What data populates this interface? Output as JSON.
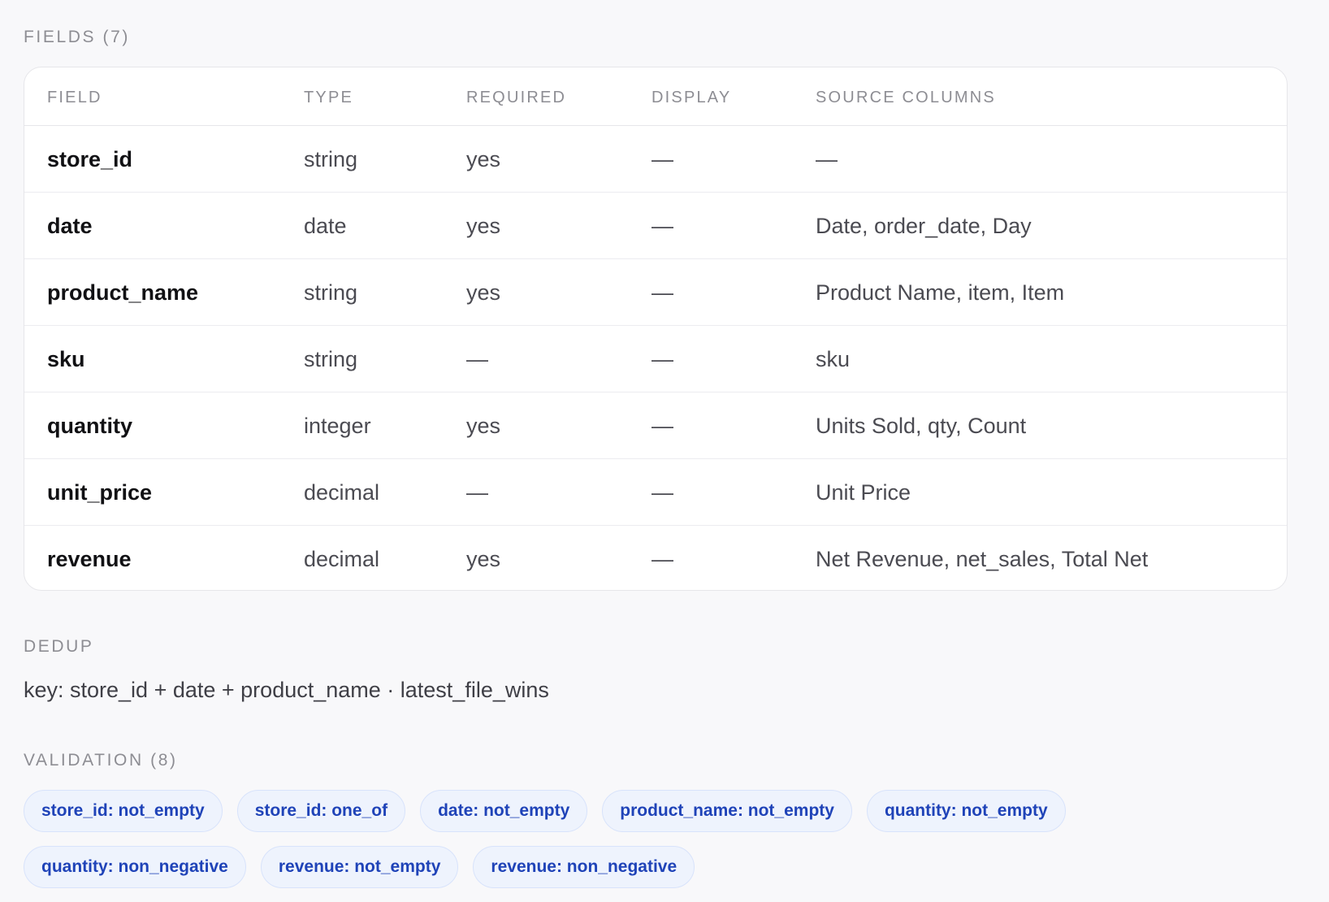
{
  "fields": {
    "title": "FIELDS (7)",
    "columns": [
      "FIELD",
      "TYPE",
      "REQUIRED",
      "DISPLAY",
      "SOURCE COLUMNS"
    ],
    "rows": [
      {
        "field": "store_id",
        "type": "string",
        "required": "yes",
        "display": "—",
        "source": "—"
      },
      {
        "field": "date",
        "type": "date",
        "required": "yes",
        "display": "—",
        "source": "Date, order_date, Day"
      },
      {
        "field": "product_name",
        "type": "string",
        "required": "yes",
        "display": "—",
        "source": "Product Name, item, Item"
      },
      {
        "field": "sku",
        "type": "string",
        "required": "—",
        "display": "—",
        "source": "sku"
      },
      {
        "field": "quantity",
        "type": "integer",
        "required": "yes",
        "display": "—",
        "source": "Units Sold, qty, Count"
      },
      {
        "field": "unit_price",
        "type": "decimal",
        "required": "—",
        "display": "—",
        "source": "Unit Price"
      },
      {
        "field": "revenue",
        "type": "decimal",
        "required": "yes",
        "display": "—",
        "source": "Net Revenue, net_sales, Total Net"
      }
    ]
  },
  "dedup": {
    "title": "DEDUP",
    "text": "key: store_id + date + product_name · latest_file_wins"
  },
  "validation": {
    "title": "VALIDATION (8)",
    "rules": [
      "store_id: not_empty",
      "store_id: one_of",
      "date: not_empty",
      "product_name: not_empty",
      "quantity: not_empty",
      "quantity: non_negative",
      "revenue: not_empty",
      "revenue: non_negative"
    ]
  },
  "colors": {
    "chip_text": "#1f43b8",
    "chip_background": "#eef3fd",
    "muted": "#8d8d93"
  }
}
